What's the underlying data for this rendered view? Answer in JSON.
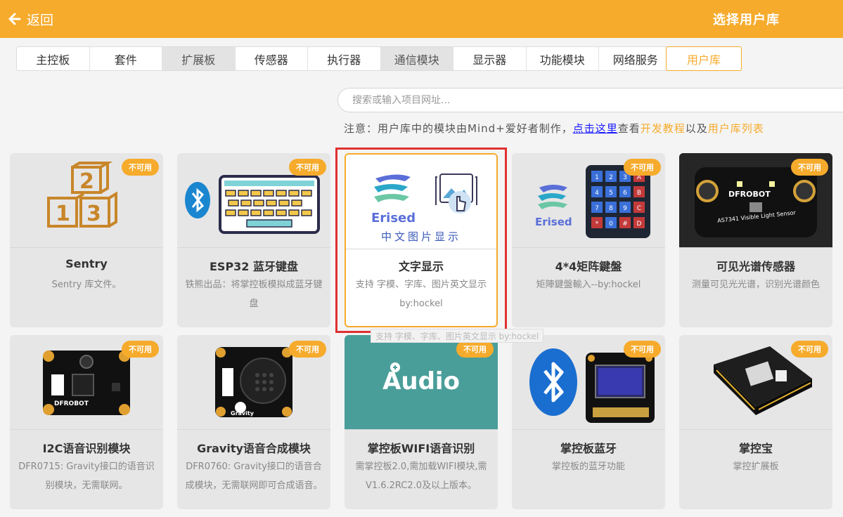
{
  "header": {
    "back_label": "返回",
    "title": "选择用户库"
  },
  "tabs": [
    {
      "label": "主控板",
      "gray": false
    },
    {
      "label": "套件",
      "gray": false
    },
    {
      "label": "扩展板",
      "gray": true
    },
    {
      "label": "传感器",
      "gray": false
    },
    {
      "label": "执行器",
      "gray": false
    },
    {
      "label": "通信模块",
      "gray": true
    },
    {
      "label": "显示器",
      "gray": false
    },
    {
      "label": "功能模块",
      "gray": false
    },
    {
      "label": "网络服务",
      "gray": false
    }
  ],
  "active_tab": "用户库",
  "search": {
    "placeholder": "搜索或输入项目网址..."
  },
  "notice": {
    "prefix": "注意：用户库中的模块由Mind+爱好者制作，",
    "link": "点击这里",
    "mid1": "查看",
    "tutorial": "开发教程",
    "mid2": "以及",
    "list": "用户库列表"
  },
  "badge_label": "不可用",
  "cards": [
    {
      "name": "Sentry",
      "desc": "Sentry 库文件。",
      "icon": "cubes-image"
    },
    {
      "name": "ESP32 蓝牙键盘",
      "desc": "铁熊出品：将掌控板模拟成蓝牙键盘",
      "icon": "keyboard-image"
    },
    {
      "name": "文字显示",
      "desc": "支持 字模、字库、图片英文显示 by:hockel",
      "icon": "erised-text-image",
      "image_caption": "中文图片显示"
    },
    {
      "name": "4*4矩阵鍵盤",
      "desc": "矩陣鍵盤輸入--by:hockel",
      "icon": "keypad-image"
    },
    {
      "name": "可见光谱传感器",
      "desc": "测量可见光光谱，识别光谱颜色",
      "icon": "light-sensor-image",
      "image_caption": "AS7341 Visible Light Sensor"
    },
    {
      "name": "I2C语音识别模块",
      "desc": "DFR0715: Gravity接口的语音识别模块，无需联网。",
      "icon": "speech-recognition-image"
    },
    {
      "name": "Gravity语音合成模块",
      "desc": "DFR0760: Gravity接口的语音合成模块，无需联网即可合成语音。",
      "icon": "speech-synthesis-image",
      "image_caption": "Gravity"
    },
    {
      "name": "掌控板WIFI语音识别",
      "desc": "需掌控板2.0,需加载WIFI模块,需V1.6.2RC2.0及以上版本。",
      "icon": "audio-image",
      "image_caption": "Audio"
    },
    {
      "name": "掌控板蓝牙",
      "desc": "掌控板的蓝牙功能",
      "icon": "bluetooth-board-image"
    },
    {
      "name": "掌控宝",
      "desc": "掌控扩展板",
      "icon": "expansion-board-image"
    }
  ],
  "tooltip": "支持 字模、字库、图片英文显示 by:hockel",
  "colors": {
    "accent": "#f6ab2c",
    "link": "#1a1aff",
    "highlight": "#e03030"
  }
}
